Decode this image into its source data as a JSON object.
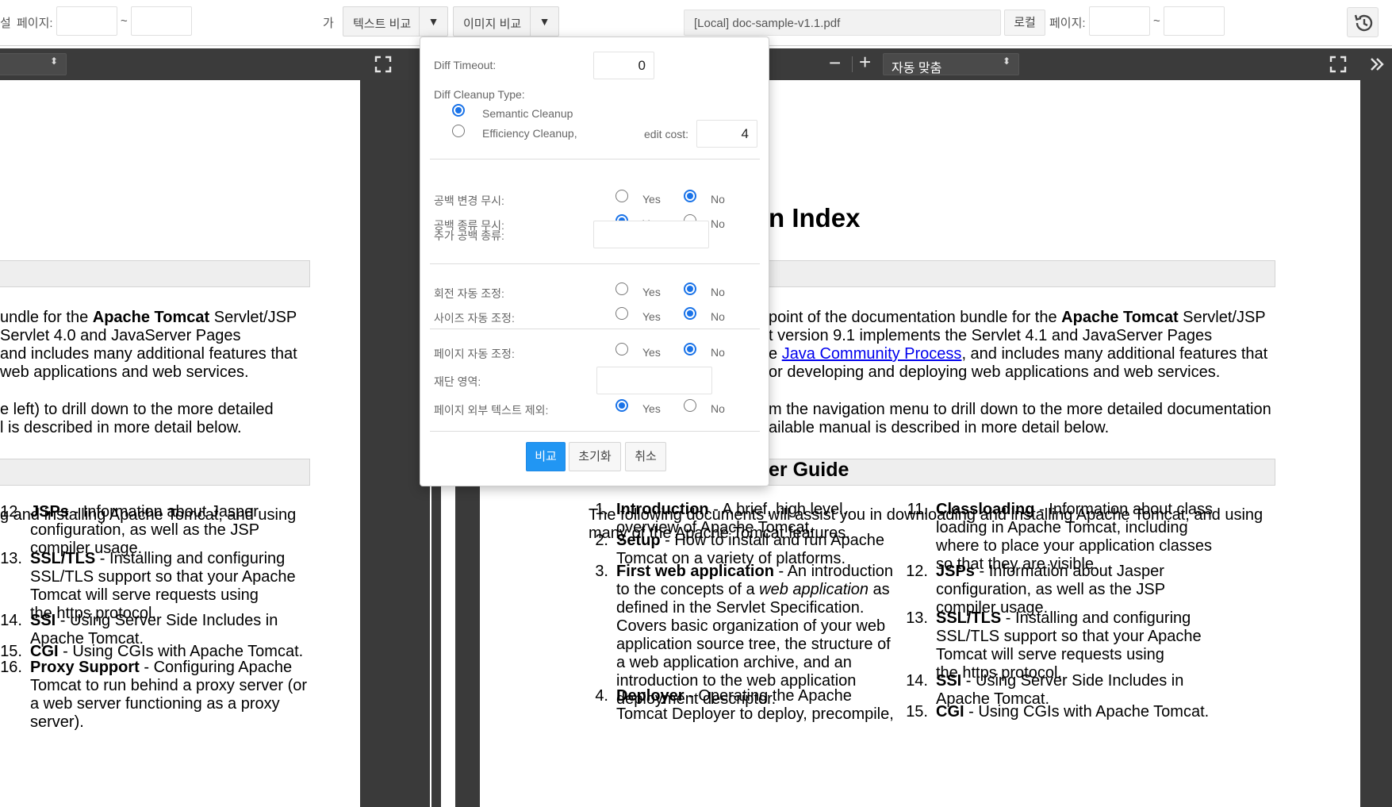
{
  "toolbar": {
    "left_cut_label": "설",
    "left_page_label": "페이지:",
    "tilde": "~",
    "font_label": "가",
    "text_compare": "텍스트 비교",
    "image_compare": "이미지 비교",
    "dropdown_arrow": "▼",
    "right_file": "[Local] doc-sample-v1.1.pdf",
    "local_button": "로컬",
    "right_page_label": "페이지:"
  },
  "left_pane": {
    "zoom_caret": "⬍",
    "list": [
      {
        "num": "12.",
        "title": "JSPs",
        "lines": [
          " - Information about Jasper",
          "configuration, as well as the JSP",
          "compiler usage."
        ]
      },
      {
        "num": "13.",
        "title": "SSL/TLS",
        "lines": [
          " - Installing and configuring",
          "SSL/TLS support so that your Apache",
          "Tomcat will serve requests using",
          "the https protocol."
        ]
      },
      {
        "num": "14.",
        "title": "SSI",
        "lines": [
          " - Using Server Side Includes in",
          "Apache Tomcat."
        ]
      },
      {
        "num": "15.",
        "title": "CGI",
        "lines": [
          " - Using CGIs with Apache Tomcat."
        ]
      },
      {
        "num": "16.",
        "title": "Proxy Support",
        "lines": [
          " - Configuring Apache",
          "Tomcat to run behind a proxy server (or",
          "a web server functioning as a proxy",
          "server)."
        ]
      }
    ],
    "para1": {
      "l1_pre": "undle for the ",
      "l1_bold": "Apache Tomcat",
      "l1_post": " Servlet/JSP",
      "l2": " Servlet 4.0 and JavaServer Pages",
      "l3": "and includes many additional features that",
      "l4": " web applications and web services."
    },
    "para2": {
      "l1": "e left) to drill down to the more detailed",
      "l2": "l is described in more detail below."
    },
    "para3": {
      "l1": "g and installing Apache Tomcat, and using"
    }
  },
  "right_pane": {
    "zoom_minus": "−",
    "zoom_plus": "+",
    "zoom_value": "자동 맞춤",
    "heading1": "n Index",
    "para1": {
      "l1_pre": "point of the documentation bundle for the ",
      "l1_bold": "Apache Tomcat",
      "l1_post": " Servlet/JSP",
      "l2": "t version 9.1 implements the Servlet 4.1 and JavaServer Pages",
      "l3_pre": "e ",
      "l3_link": "Java Community Process",
      "l3_post": ", and includes many additional features that",
      "l4": "or developing and deploying web applications and web services."
    },
    "para2": {
      "l1": "m the navigation menu to drill down to the more detailed documentation",
      "l2": "ailable manual is described in more detail below."
    },
    "heading2": "er Guide",
    "para3": {
      "l1": "The following documents will assist you in downloading and installing Apache Tomcat, and using",
      "l2": "many of the Apache Tomcat features."
    },
    "list_left": [
      {
        "num": "1.",
        "title": "Introduction",
        "lines": [
          " - A brief, high level,",
          "overview of Apache Tomcat."
        ]
      },
      {
        "num": "2.",
        "title": "Setup",
        "lines": [
          " - How to install and run Apache",
          "Tomcat on a variety of platforms."
        ]
      },
      {
        "num": "3.",
        "title": "First web application",
        "lines": [
          " - An introduction",
          "to the concepts of a |web application| as",
          "defined in the Servlet Specification.",
          "Covers basic organization of your web",
          "application source tree, the structure of",
          "a web application archive, and an",
          "introduction to the web application",
          "deployment descriptor."
        ]
      },
      {
        "num": "4.",
        "title": "Deployer",
        "lines": [
          " - Operating the Apache",
          "Tomcat Deployer to deploy, precompile,"
        ]
      }
    ],
    "list_right": [
      {
        "num": "11.",
        "title": "Classloading",
        "lines": [
          " - Information about class",
          "loading in Apache Tomcat, including",
          "where to place your application classes",
          "so that they are visible."
        ]
      },
      {
        "num": "12.",
        "title": "JSPs",
        "lines": [
          " - Information about Jasper",
          "configuration, as well as the JSP",
          "compiler usage."
        ]
      },
      {
        "num": "13.",
        "title": "SSL/TLS",
        "lines": [
          " - Installing and configuring",
          "SSL/TLS support so that your Apache",
          "Tomcat will serve requests using",
          "the https protocol."
        ]
      },
      {
        "num": "14.",
        "title": "SSI",
        "lines": [
          " - Using Server Side Includes in",
          "Apache Tomcat."
        ]
      },
      {
        "num": "15.",
        "title": "CGI",
        "lines": [
          " - Using CGIs with Apache Tomcat."
        ]
      }
    ]
  },
  "options": {
    "diff_timeout_label": "Diff Timeout:",
    "diff_timeout_value": "0",
    "cleanup_type_label": "Diff Cleanup Type:",
    "semantic_label": "Semantic Cleanup",
    "efficiency_label": "Efficiency Cleanup,",
    "edit_cost_label": "edit cost:",
    "edit_cost_value": "4",
    "yes": "Yes",
    "no": "No",
    "rows": [
      {
        "label": "공백 변경 무시:",
        "value": "No"
      },
      {
        "label": "공백 종류 무시:",
        "value": "Yes"
      },
      {
        "label": "회전 자동 조정:",
        "value": "No"
      },
      {
        "label": "사이즈 자동 조정:",
        "value": "No"
      },
      {
        "label": "페이지 자동 조정:",
        "value": "No"
      },
      {
        "label": "페이지 외부 텍스트 제외:",
        "value": "Yes"
      }
    ],
    "extra_whitespace_label": "추가 공백 종류:",
    "crop_area_label": "재단 영역:",
    "compare_button": "비교",
    "reset_button": "초기화",
    "cancel_button": "취소"
  },
  "colors": {
    "accent": "#2196f3",
    "radio": "#1a73e8",
    "viewer_bg": "#3a3a3a"
  }
}
